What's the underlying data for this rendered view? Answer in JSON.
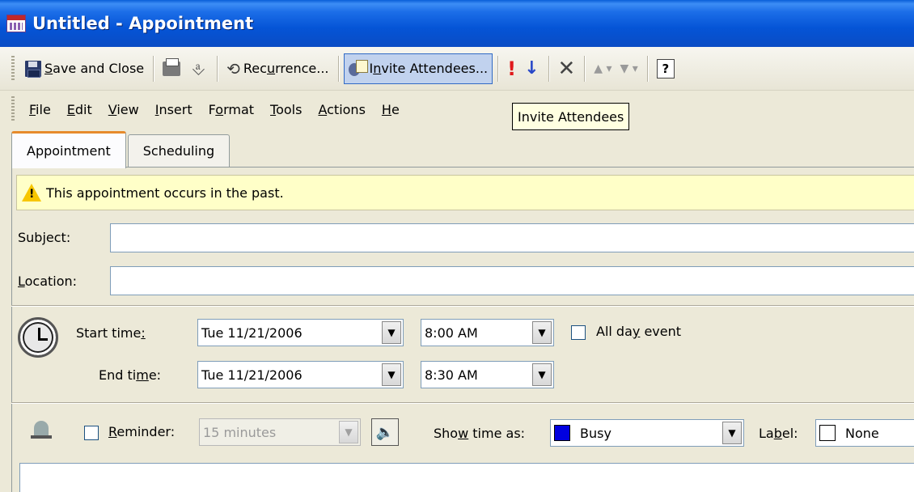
{
  "window": {
    "title": "Untitled - Appointment"
  },
  "toolbar": {
    "save_close": {
      "mnemonic": "S",
      "rest": "ave and Close"
    },
    "recurrence": {
      "pre": "Rec",
      "mnemonic": "u",
      "rest": "rrence..."
    },
    "invite": {
      "pre": "I",
      "mnemonic": "n",
      "rest": "vite Attendees..."
    }
  },
  "menu": {
    "file": {
      "mnemonic": "F",
      "rest": "ile"
    },
    "edit": {
      "mnemonic": "E",
      "rest": "dit"
    },
    "view": {
      "mnemonic": "V",
      "rest": "iew"
    },
    "insert": {
      "mnemonic": "I",
      "rest": "nsert"
    },
    "format": {
      "pre": "F",
      "mnemonic": "o",
      "rest": "rmat"
    },
    "tools": {
      "mnemonic": "T",
      "rest": "ools"
    },
    "actions": {
      "mnemonic": "A",
      "rest": "ctions"
    },
    "help": {
      "mnemonic": "H",
      "rest": "e"
    }
  },
  "tooltip": "Invite Attendees",
  "tabs": {
    "appointment": "Appointment",
    "scheduling": "Scheduling"
  },
  "warning": "This appointment occurs in the past.",
  "form": {
    "subject": {
      "pre": "Sub",
      "mnemonic": "j",
      "rest": "ect:"
    },
    "location": {
      "mnemonic": "L",
      "rest": "ocation:"
    },
    "start_label": {
      "pre": "Start time",
      "mnemonic": ":",
      "rest": ""
    },
    "end_label": {
      "pre": "End ti",
      "mnemonic": "m",
      "rest": "e:"
    },
    "start_date": "Tue 11/21/2006",
    "start_time": "8:00 AM",
    "end_date": "Tue 11/21/2006",
    "end_time": "8:30 AM",
    "all_day": {
      "pre": "All da",
      "mnemonic": "y",
      "rest": " event"
    },
    "reminder": {
      "mnemonic": "R",
      "rest": "eminder:"
    },
    "reminder_value": "15 minutes",
    "show_time_as": {
      "pre": "Sho",
      "mnemonic": "w",
      "rest": " time as:"
    },
    "show_time_value": "Busy",
    "busy_color": "#0000e0",
    "label_text": {
      "pre": "La",
      "mnemonic": "b",
      "rest": "el:"
    },
    "label_value": "None"
  }
}
